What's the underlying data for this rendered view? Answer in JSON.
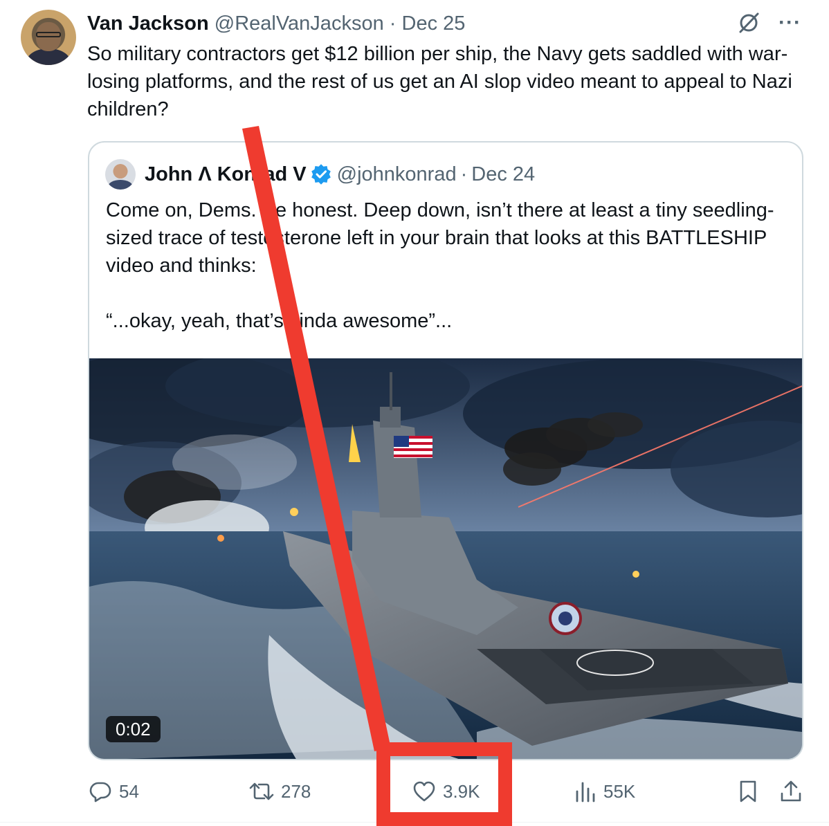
{
  "tweet": {
    "author_name": "Van Jackson",
    "author_handle": "@RealVanJackson",
    "separator": "·",
    "date": "Dec 25",
    "more_label": "···",
    "text": "So military contractors get $12 billion per ship, the Navy gets saddled with war-losing platforms, and the rest of us get an AI slop video meant to appeal to Nazi children?"
  },
  "quote": {
    "author_name": "John Λ Konrad V",
    "author_handle": "@johnkonrad",
    "separator": "·",
    "date": "Dec 24",
    "text_p1": "Come on, Dems. Be honest. Deep down, isn’t there at least a tiny seedling-sized trace of testosterone left in your brain that looks at this BATTLESHIP video and thinks:",
    "text_p2": "“...okay, yeah, that’s kinda awesome”...",
    "video_duration": "0:02",
    "media_description_icon": "warship-video-thumbnail"
  },
  "actions": {
    "replies": "54",
    "reposts": "278",
    "likes": "3.9K",
    "views": "55K"
  },
  "colors": {
    "annotation_red": "#ef3b2f",
    "muted_text": "#536471",
    "verified_blue": "#1d9bf0"
  }
}
